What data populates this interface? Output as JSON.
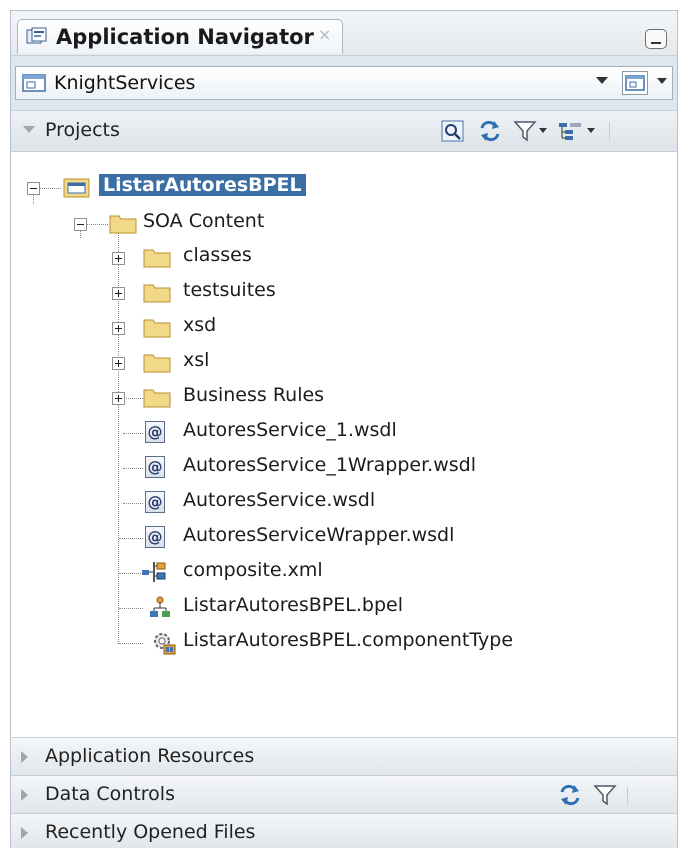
{
  "window": {
    "title": "Application Navigator",
    "close_glyph": "×"
  },
  "application": {
    "name": "KnightServices"
  },
  "projects": {
    "label": "Projects"
  },
  "tree": {
    "root": "ListarAutoresBPEL",
    "soa_content": "SOA Content",
    "folders": [
      "classes",
      "testsuites",
      "xsd",
      "xsl",
      "Business Rules"
    ],
    "wsdl_files": [
      "AutoresService_1.wsdl",
      "AutoresService_1Wrapper.wsdl",
      "AutoresService.wsdl",
      "AutoresServiceWrapper.wsdl"
    ],
    "wsdl_glyph": "@",
    "composite": "composite.xml",
    "bpel": "ListarAutoresBPEL.bpel",
    "component_type": "ListarAutoresBPEL.componentType"
  },
  "sections": {
    "application_resources": "Application Resources",
    "data_controls": "Data Controls",
    "recently_opened": "Recently Opened Files"
  },
  "colors": {
    "selection": "#3a6ea5",
    "folder": "#f2d98a",
    "accent_blue": "#3d76b8"
  }
}
